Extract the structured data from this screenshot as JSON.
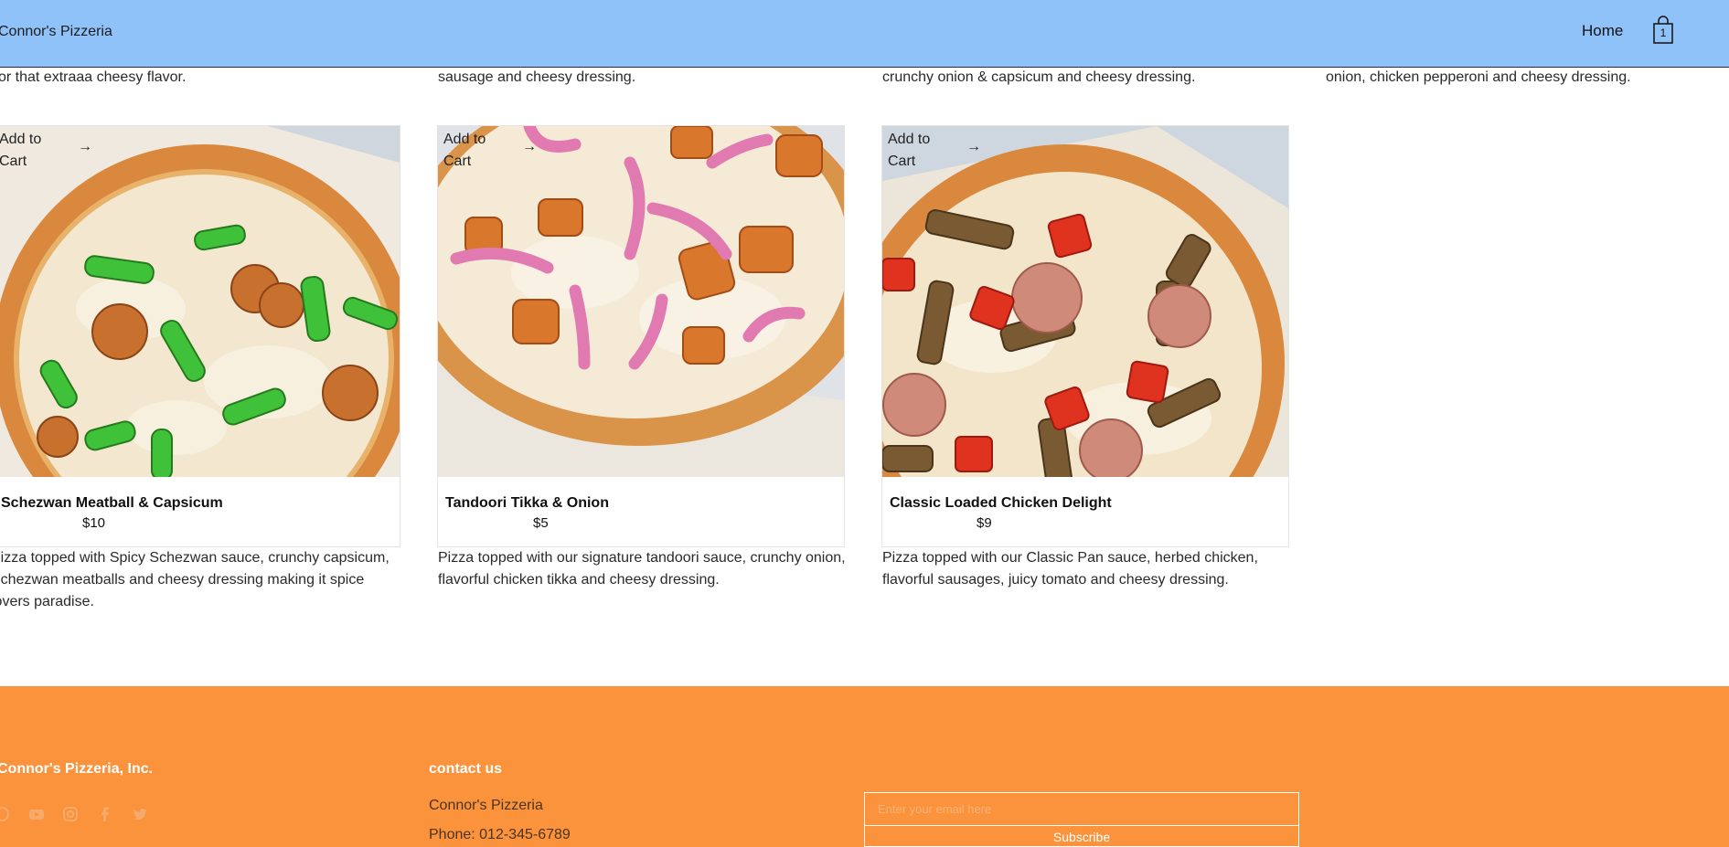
{
  "header": {
    "brand": "Connor's Pizzeria",
    "nav_home": "Home",
    "cart_count": "1"
  },
  "top_descriptions": [
    "or that extraaa cheesy flavor.",
    "sausage and cheesy dressing.",
    "crunchy onion & capsicum and cheesy dressing.",
    "onion, chicken pepperoni and cheesy dressing."
  ],
  "products": [
    {
      "add_to_cart": "Add to Cart",
      "name": "Schezwan Meatball & Capsicum",
      "price": "$10",
      "description": "Pizza topped with Spicy Schezwan sauce, crunchy capsicum, Schezwan meatballs and cheesy dressing making it spice lovers paradise."
    },
    {
      "add_to_cart": "Add to Cart",
      "name": "Tandoori Tikka & Onion",
      "price": "$5",
      "description": "Pizza topped with our signature tandoori sauce, crunchy onion, flavorful chicken tikka and cheesy dressing."
    },
    {
      "add_to_cart": "Add to Cart",
      "name": "Classic Loaded Chicken Delight",
      "price": "$9",
      "description": "Pizza topped with our Classic Pan sauce, herbed chicken, flavorful sausages, juicy tomato and cheesy dressing."
    }
  ],
  "footer": {
    "company": "Connor's Pizzeria, Inc.",
    "contact_title": "contact us",
    "contact_name": "Connor's Pizzeria",
    "phone": "Phone: 012-345-6789",
    "email_placeholder": "Enter your email here",
    "subscribe_label": "Subscribe",
    "social_icons": [
      "pinterest-icon",
      "youtube-icon",
      "instagram-icon",
      "facebook-icon",
      "twitter-icon"
    ]
  },
  "colors": {
    "header_bg": "#90c2fa",
    "footer_bg": "#fb923c",
    "footer_title": "#ffffff"
  }
}
